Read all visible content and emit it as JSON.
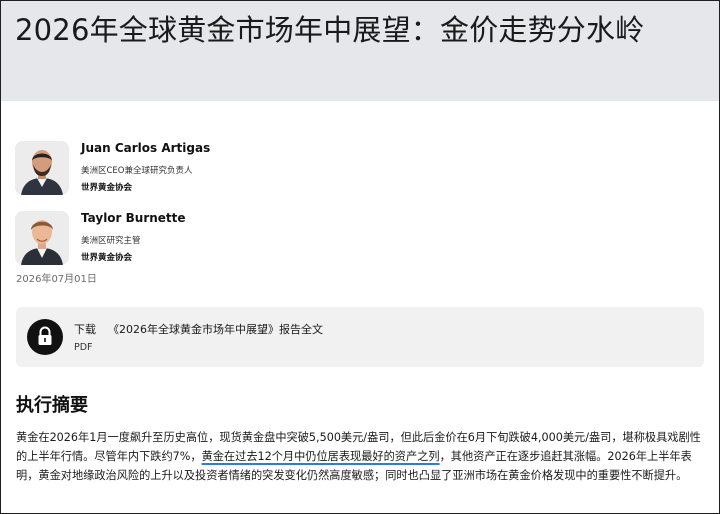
{
  "article": {
    "title": "2026年全球黄金市场年中展望：金价走势分水岭"
  },
  "authors": [
    {
      "name": "Juan Carlos Artigas",
      "role": "美洲区CEO兼全球研究负责人",
      "org": "世界黄金协会",
      "avatar_icon": "person-portrait-beard-icon"
    },
    {
      "name": "Taylor Burnette",
      "role": "美洲区研究主管",
      "org": "世界黄金协会",
      "avatar_icon": "person-portrait-icon"
    }
  ],
  "date": "2026年07月01日",
  "download": {
    "icon": "lock-icon",
    "verb": "下载",
    "title": "《2026年全球黄金市场年中展望》报告全文",
    "format": "PDF"
  },
  "summary": {
    "heading": "执行摘要",
    "text_before": "黄金在2026年1月一度飙升至历史高位，现货黄金盘中突破5,500美元/盎司，但此后金价在6月下旬跌破4,000美元/盎司，堪称极具戏剧性的上半年行情。尽管年内下跌约7%，",
    "link_text": "黄金在过去12个月中仍位居表现最好的资产之列",
    "text_after": "，其他资产正在逐步追赶其涨幅。2026年上半年表明，黄金对地缘政治风险的上升以及投资者情绪的突发变化仍然高度敏感；同时也凸显了亚洲市场在黄金价格发现中的重要性不断提升。",
    "link_color": "#2c7be5"
  }
}
